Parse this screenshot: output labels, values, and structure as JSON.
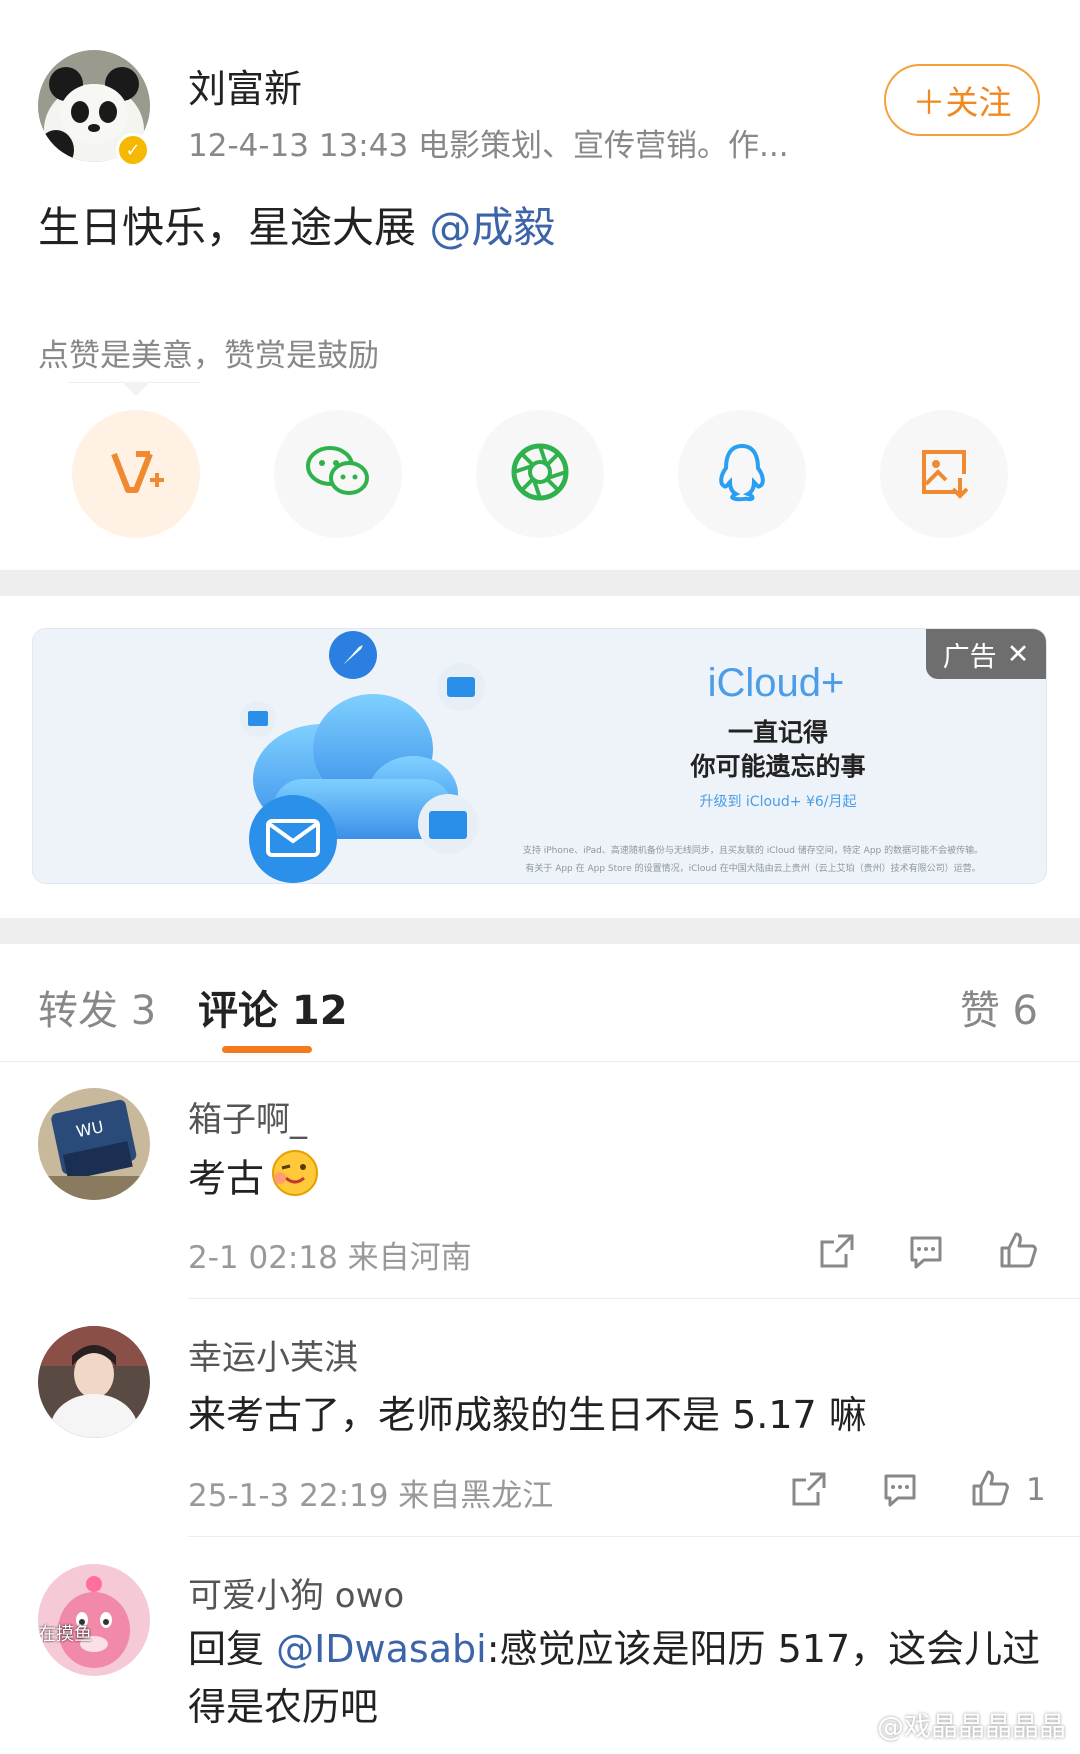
{
  "post": {
    "author_name": "刘富新",
    "meta": "12-4-13 13:43  电影策划、宣传营销。作...",
    "follow_label": "＋关注",
    "content_prefix": "生日快乐，星途大展 ",
    "content_mention": "@成毅",
    "reward_hint": "点赞是美意，赞赏是鼓励"
  },
  "share_buttons": [
    {
      "icon": "vplus-reward-icon"
    },
    {
      "icon": "wechat-icon"
    },
    {
      "icon": "moments-icon"
    },
    {
      "icon": "qq-icon"
    },
    {
      "icon": "save-image-icon"
    }
  ],
  "ad": {
    "tag": "广告",
    "close": "✕",
    "title": "iCloud+",
    "line1": "一直记得",
    "line2": "你可能遗忘的事",
    "offer": "升级到 iCloud+ ¥6/月起",
    "fine1": "支持 iPhone、iPad、高速随机备份与无线同步，且买友联的 iCloud 储存空间，特定 App 的数据可能不会被传输。",
    "fine2": "有关于 App 在 App Store 的设置情况，iCloud 在中国大陆由云上贵州（云上艾珀（贵州）技术有限公司）运营。"
  },
  "tabs": {
    "repost": "转发 3",
    "comments": "评论 12",
    "likes": "赞 6"
  },
  "comments": [
    {
      "name": "箱子啊_",
      "text": "考古",
      "time": "2-1 02:18  来自河南",
      "likes": ""
    },
    {
      "name": "幸运小芙淇",
      "text": "来考古了，老师成毅的生日不是 5.17 嘛",
      "time": "25-1-3 22:19  来自黑龙江",
      "likes": "1"
    },
    {
      "name": "可爱小狗 owo",
      "text_prefix": "回复 ",
      "text_mention": "@IDwasabi",
      "text_rest": ":感觉应该是阳历 517，这会儿过得是农历吧",
      "avatar_label": "在摸鱼"
    }
  ],
  "watermark": "@戏晶晶晶晶晶"
}
